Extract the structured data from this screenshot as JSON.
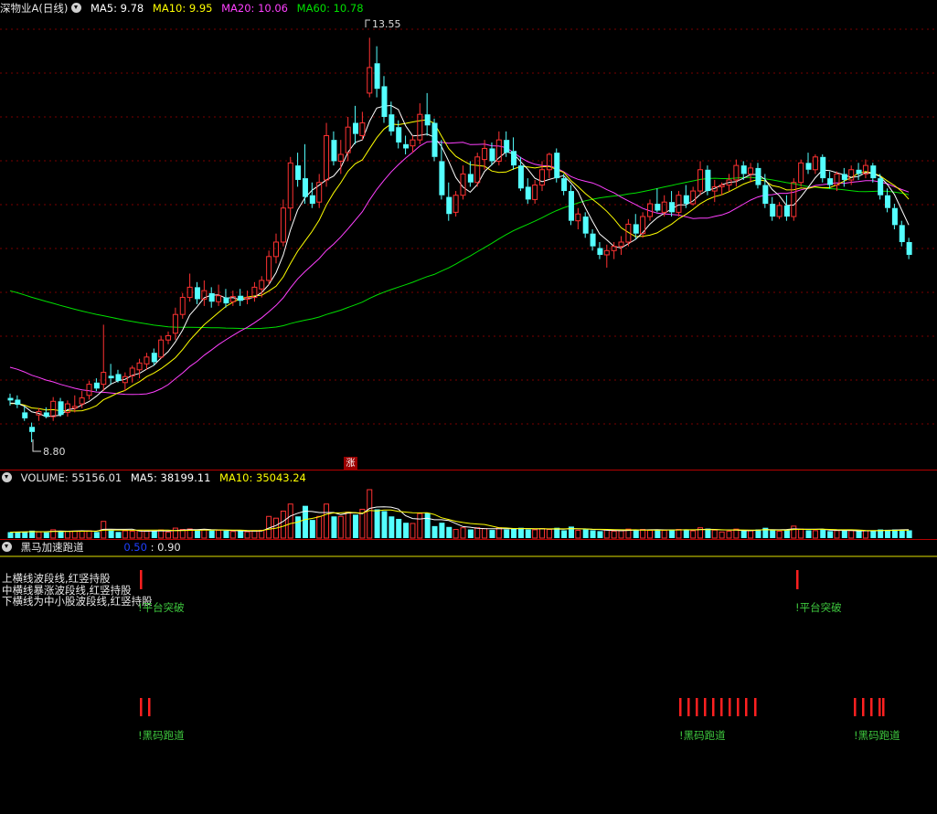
{
  "main": {
    "title": "深物业A(日线)",
    "ma_labels": [
      {
        "text": "MA5: 9.78",
        "color": "#ffffff"
      },
      {
        "text": "MA10: 9.95",
        "color": "#ffff00"
      },
      {
        "text": "MA20: 10.06",
        "color": "#ff40ff"
      },
      {
        "text": "MA60: 10.78",
        "color": "#00e000"
      }
    ],
    "high_label": "13.55",
    "low_label": "8.80",
    "zhang_badge": "涨"
  },
  "volume": {
    "title": "VOLUME: 55156.01",
    "ma5": "MA5: 38199.11",
    "ma10": "MA10: 35043.24"
  },
  "indicator": {
    "title": "黑马加速跑道",
    "val1": "0.50",
    "val2": ": 0.90",
    "notes": [
      "上横线波段线,红竖持股",
      "中横线暴涨波段线,红竖持股",
      "下横线为中小股波段线,红竖持股"
    ],
    "signals": [
      {
        "label": "!平台突破"
      },
      {
        "label": "!平台突破"
      },
      {
        "label": "!黑码跑道"
      },
      {
        "label": "!黑码跑道"
      },
      {
        "label": "!黑码跑道"
      }
    ]
  },
  "colors": {
    "up": "#ff3232",
    "down": "#54ffff",
    "ma5": "#ffffff",
    "ma10": "#ffff00",
    "ma20": "#ff40ff",
    "ma60": "#00e000",
    "signal": "#ff2020"
  },
  "chart_data": {
    "type": "candlestick",
    "price_range": [
      8.8,
      13.55
    ],
    "ma5_last": 9.78,
    "ma10_last": 9.95,
    "ma20_last": 10.06,
    "ma60_last": 10.78,
    "volume_last": 55156.01,
    "volume_ma5": 38199.11,
    "volume_ma10": 35043.24,
    "indicator_values": [
      0.5,
      0.9
    ],
    "candles": [
      [
        9.32,
        9.37,
        9.23,
        9.29
      ],
      [
        9.3,
        9.35,
        9.2,
        9.24
      ],
      [
        9.15,
        9.22,
        9.05,
        9.08
      ],
      [
        8.98,
        9.03,
        8.8,
        8.92
      ],
      [
        9.12,
        9.2,
        9.05,
        9.16
      ],
      [
        9.15,
        9.21,
        9.08,
        9.1
      ],
      [
        9.1,
        9.33,
        9.05,
        9.28
      ],
      [
        9.28,
        9.32,
        9.1,
        9.12
      ],
      [
        9.15,
        9.29,
        9.1,
        9.25
      ],
      [
        9.2,
        9.35,
        9.15,
        9.22
      ],
      [
        9.25,
        9.4,
        9.2,
        9.32
      ],
      [
        9.35,
        9.52,
        9.3,
        9.48
      ],
      [
        9.5,
        9.55,
        9.4,
        9.43
      ],
      [
        9.48,
        10.18,
        9.4,
        9.62
      ],
      [
        9.58,
        9.72,
        9.48,
        9.55
      ],
      [
        9.6,
        9.65,
        9.5,
        9.52
      ],
      [
        9.5,
        9.62,
        9.4,
        9.57
      ],
      [
        9.58,
        9.7,
        9.5,
        9.67
      ],
      [
        9.65,
        9.78,
        9.55,
        9.73
      ],
      [
        9.72,
        9.85,
        9.65,
        9.8
      ],
      [
        9.85,
        9.9,
        9.7,
        9.74
      ],
      [
        9.8,
        10.05,
        9.78,
        10.0
      ],
      [
        10.0,
        10.1,
        9.95,
        10.05
      ],
      [
        10.08,
        10.38,
        10.0,
        10.3
      ],
      [
        10.3,
        10.55,
        10.25,
        10.5
      ],
      [
        10.5,
        10.78,
        10.45,
        10.62
      ],
      [
        10.62,
        10.68,
        10.42,
        10.48
      ],
      [
        10.48,
        10.7,
        10.4,
        10.58
      ],
      [
        10.55,
        10.62,
        10.38,
        10.45
      ],
      [
        10.45,
        10.65,
        10.4,
        10.52
      ],
      [
        10.5,
        10.6,
        10.38,
        10.43
      ],
      [
        10.45,
        10.58,
        10.4,
        10.51
      ],
      [
        10.52,
        10.6,
        10.4,
        10.46
      ],
      [
        10.48,
        10.58,
        10.42,
        10.5
      ],
      [
        10.5,
        10.68,
        10.45,
        10.62
      ],
      [
        10.6,
        10.75,
        10.5,
        10.7
      ],
      [
        10.7,
        11.05,
        10.65,
        10.98
      ],
      [
        10.98,
        11.25,
        10.9,
        11.15
      ],
      [
        11.15,
        11.65,
        11.1,
        11.55
      ],
      [
        11.55,
        12.15,
        11.4,
        12.08
      ],
      [
        12.05,
        12.2,
        11.8,
        11.88
      ],
      [
        11.9,
        12.3,
        11.6,
        11.68
      ],
      [
        11.7,
        11.85,
        11.55,
        11.6
      ],
      [
        11.62,
        11.95,
        11.55,
        11.85
      ],
      [
        11.88,
        12.55,
        11.8,
        12.4
      ],
      [
        12.35,
        12.45,
        12.05,
        12.1
      ],
      [
        12.1,
        12.35,
        11.95,
        12.18
      ],
      [
        12.2,
        12.62,
        12.1,
        12.5
      ],
      [
        12.55,
        12.75,
        12.3,
        12.42
      ],
      [
        12.4,
        12.68,
        12.35,
        12.55
      ],
      [
        12.9,
        13.55,
        12.85,
        13.2
      ],
      [
        13.25,
        13.45,
        12.85,
        12.95
      ],
      [
        12.98,
        13.1,
        12.55,
        12.62
      ],
      [
        12.65,
        12.8,
        12.4,
        12.45
      ],
      [
        12.5,
        12.58,
        12.25,
        12.32
      ],
      [
        12.3,
        12.4,
        12.18,
        12.25
      ],
      [
        12.28,
        12.4,
        12.2,
        12.35
      ],
      [
        12.35,
        12.78,
        12.3,
        12.65
      ],
      [
        12.65,
        12.9,
        12.4,
        12.52
      ],
      [
        12.55,
        12.6,
        12.1,
        12.15
      ],
      [
        12.1,
        12.35,
        11.65,
        11.7
      ],
      [
        11.68,
        11.85,
        11.4,
        11.48
      ],
      [
        11.5,
        11.75,
        11.45,
        11.7
      ],
      [
        11.7,
        12.05,
        11.65,
        11.95
      ],
      [
        11.95,
        12.1,
        11.8,
        11.85
      ],
      [
        11.85,
        12.2,
        11.8,
        12.15
      ],
      [
        12.12,
        12.35,
        12.0,
        12.25
      ],
      [
        12.25,
        12.32,
        12.05,
        12.1
      ],
      [
        12.1,
        12.45,
        12.05,
        12.35
      ],
      [
        12.35,
        12.45,
        12.15,
        12.2
      ],
      [
        12.22,
        12.38,
        12.0,
        12.05
      ],
      [
        12.05,
        12.15,
        11.75,
        11.78
      ],
      [
        11.8,
        11.9,
        11.6,
        11.65
      ],
      [
        11.65,
        11.88,
        11.6,
        11.82
      ],
      [
        11.82,
        12.1,
        11.75,
        12.0
      ],
      [
        12.0,
        12.2,
        11.9,
        12.18
      ],
      [
        12.2,
        12.25,
        11.85,
        11.9
      ],
      [
        11.9,
        11.95,
        11.7,
        11.75
      ],
      [
        11.75,
        11.82,
        11.35,
        11.4
      ],
      [
        11.4,
        11.55,
        11.3,
        11.48
      ],
      [
        11.45,
        11.5,
        11.2,
        11.25
      ],
      [
        11.25,
        11.3,
        11.05,
        11.1
      ],
      [
        11.08,
        11.15,
        10.95,
        11.0
      ],
      [
        11.0,
        11.12,
        10.85,
        11.05
      ],
      [
        11.05,
        11.15,
        10.95,
        11.1
      ],
      [
        11.1,
        11.22,
        11.0,
        11.15
      ],
      [
        11.15,
        11.42,
        11.1,
        11.36
      ],
      [
        11.36,
        11.48,
        11.18,
        11.25
      ],
      [
        11.25,
        11.5,
        11.2,
        11.45
      ],
      [
        11.45,
        11.65,
        11.4,
        11.6
      ],
      [
        11.6,
        11.78,
        11.5,
        11.52
      ],
      [
        11.5,
        11.7,
        11.45,
        11.62
      ],
      [
        11.62,
        11.75,
        11.45,
        11.5
      ],
      [
        11.5,
        11.75,
        11.45,
        11.7
      ],
      [
        11.7,
        11.82,
        11.55,
        11.6
      ],
      [
        11.6,
        11.8,
        11.58,
        11.75
      ],
      [
        11.75,
        12.1,
        11.7,
        12.0
      ],
      [
        12.0,
        12.05,
        11.7,
        11.75
      ],
      [
        11.75,
        11.88,
        11.62,
        11.8
      ],
      [
        11.8,
        11.85,
        11.7,
        11.82
      ],
      [
        11.82,
        11.95,
        11.75,
        11.88
      ],
      [
        11.88,
        12.12,
        11.8,
        12.05
      ],
      [
        12.05,
        12.1,
        11.88,
        11.95
      ],
      [
        11.95,
        12.08,
        11.85,
        12.02
      ],
      [
        12.02,
        12.08,
        11.78,
        11.82
      ],
      [
        11.82,
        11.95,
        11.55,
        11.6
      ],
      [
        11.6,
        11.68,
        11.4,
        11.45
      ],
      [
        11.45,
        11.62,
        11.42,
        11.58
      ],
      [
        11.58,
        11.7,
        11.4,
        11.45
      ],
      [
        11.45,
        11.9,
        11.4,
        11.85
      ],
      [
        11.85,
        12.12,
        11.8,
        12.08
      ],
      [
        12.08,
        12.2,
        11.95,
        12.0
      ],
      [
        12.0,
        12.18,
        11.95,
        12.15
      ],
      [
        12.15,
        12.18,
        11.85,
        11.9
      ],
      [
        11.9,
        11.98,
        11.78,
        11.82
      ],
      [
        11.82,
        11.98,
        11.75,
        11.95
      ],
      [
        11.95,
        12.02,
        11.8,
        11.88
      ],
      [
        11.88,
        12.05,
        11.82,
        12.0
      ],
      [
        12.0,
        12.08,
        11.88,
        11.95
      ],
      [
        11.95,
        12.12,
        11.9,
        12.05
      ],
      [
        12.05,
        12.08,
        11.85,
        11.9
      ],
      [
        11.9,
        11.95,
        11.65,
        11.7
      ],
      [
        11.7,
        11.78,
        11.5,
        11.55
      ],
      [
        11.55,
        11.6,
        11.3,
        11.35
      ],
      [
        11.35,
        11.4,
        11.1,
        11.15
      ],
      [
        11.15,
        11.2,
        10.95,
        11.0
      ]
    ]
  }
}
